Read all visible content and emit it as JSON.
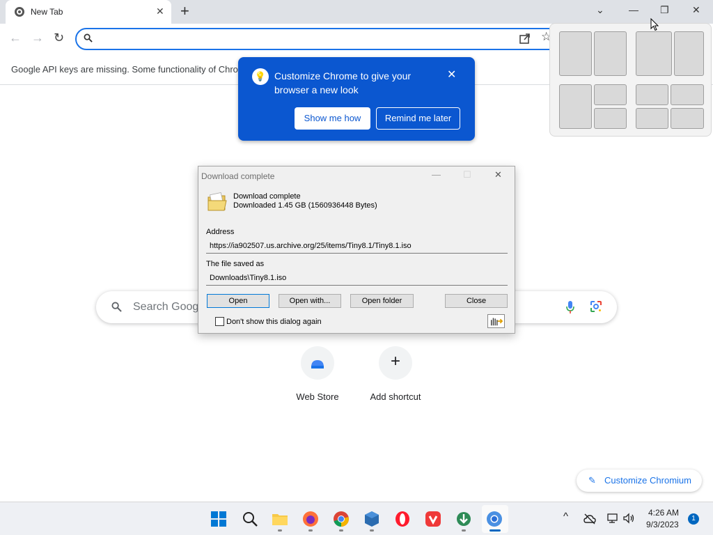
{
  "tab": {
    "title": "New Tab",
    "close": "✕"
  },
  "window": {
    "dropdown": "⌄",
    "minimize": "—",
    "restore": "❐",
    "close": "✕"
  },
  "toolbar": {
    "back": "←",
    "forward": "→",
    "reload": "↻",
    "omnibox_value": "",
    "star": "☆"
  },
  "infobar": {
    "text": "Google API keys are missing. Some functionality of Chror"
  },
  "bubble": {
    "icon": "💡",
    "text": "Customize Chrome to give your browser a new look",
    "close": "✕",
    "show_me_how": "Show me how",
    "remind_me_later": "Remind me later"
  },
  "ntp": {
    "search_placeholder": "Search Googl",
    "shortcuts": [
      {
        "label": "Web Store"
      },
      {
        "label": "Add shortcut",
        "glyph": "+"
      }
    ],
    "customize_label": "Customize Chromium",
    "customize_glyph": "✎"
  },
  "dialog": {
    "title": "Download complete",
    "heading": "Download complete",
    "subheading": "Downloaded 1.45  GB (1560936448 Bytes)",
    "address_label": "Address",
    "address_value": "https://ia902507.us.archive.org/25/items/Tiny8.1/Tiny8.1.iso",
    "saved_label": "The file saved as",
    "saved_value": "Downloads\\Tiny8.1.iso",
    "buttons": {
      "open": "Open",
      "open_with": "Open with...",
      "open_folder": "Open folder",
      "close": "Close"
    },
    "checkbox_label": "Don't show this dialog again",
    "ctl_min": "—",
    "ctl_max": "☐",
    "ctl_close": "✕"
  },
  "taskbar": {
    "tray_chevron": "^",
    "time": "4:26 AM",
    "date": "9/3/2023",
    "notifications": "1"
  },
  "colors": {
    "accent": "#1a73e8",
    "bubble": "#0b57d0",
    "taskbar": "#eef0f4"
  }
}
